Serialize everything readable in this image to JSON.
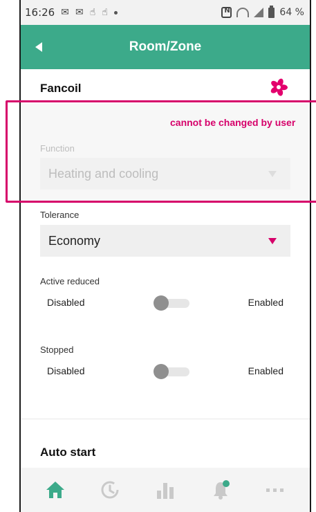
{
  "status_bar": {
    "time": "16:26",
    "battery_text": "64 %"
  },
  "app_bar": {
    "title": "Room/Zone",
    "color": "#3caa8a"
  },
  "fancoil": {
    "title": "Fancoil",
    "icon": "fan-icon"
  },
  "annotation": {
    "text": "cannot be changed by user",
    "color": "#d6006a"
  },
  "function_field": {
    "label": "Function",
    "value": "Heating and cooling"
  },
  "tolerance_field": {
    "label": "Tolerance",
    "value": "Economy"
  },
  "active_reduced": {
    "label": "Active reduced",
    "off_label": "Disabled",
    "on_label": "Enabled"
  },
  "stopped": {
    "label": "Stopped",
    "off_label": "Disabled",
    "on_label": "Enabled"
  },
  "auto_start": {
    "title": "Auto start"
  },
  "bottom_nav": {
    "items": [
      "home-icon",
      "history-icon",
      "chart-icon",
      "notification-bell-icon",
      "more-icon"
    ],
    "active_color": "#3caa8a"
  }
}
